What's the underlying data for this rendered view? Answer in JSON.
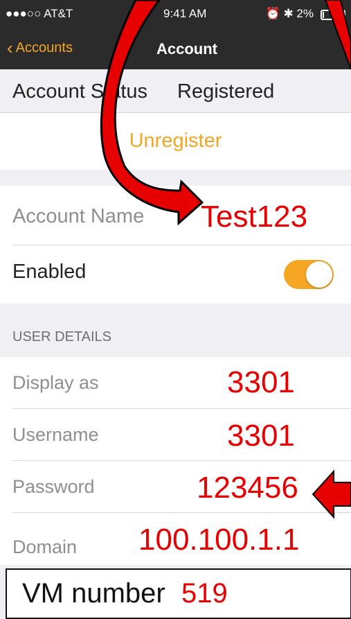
{
  "status_bar": {
    "carrier": "●●●○○ AT&T",
    "time": "9:41 AM",
    "battery": "2%"
  },
  "nav": {
    "back_label": "Accounts",
    "title": "Account"
  },
  "account_status": {
    "label": "Account Status",
    "value": "Registered"
  },
  "unregister_label": "Unregister",
  "account_name": {
    "label": "Account Name",
    "value": "Test123"
  },
  "enabled": {
    "label": "Enabled",
    "on": true
  },
  "user_details": {
    "header": "USER DETAILS",
    "rows": [
      {
        "label": "Display as",
        "value": "3301"
      },
      {
        "label": "Username",
        "value": "3301"
      },
      {
        "label": "Password",
        "value": "123456"
      },
      {
        "label": "Domain",
        "value": "100.100.1.1"
      }
    ]
  },
  "vm": {
    "label": "VM number",
    "value": "519"
  },
  "colors": {
    "accent": "#f5a623",
    "annotation": "#e60000"
  }
}
